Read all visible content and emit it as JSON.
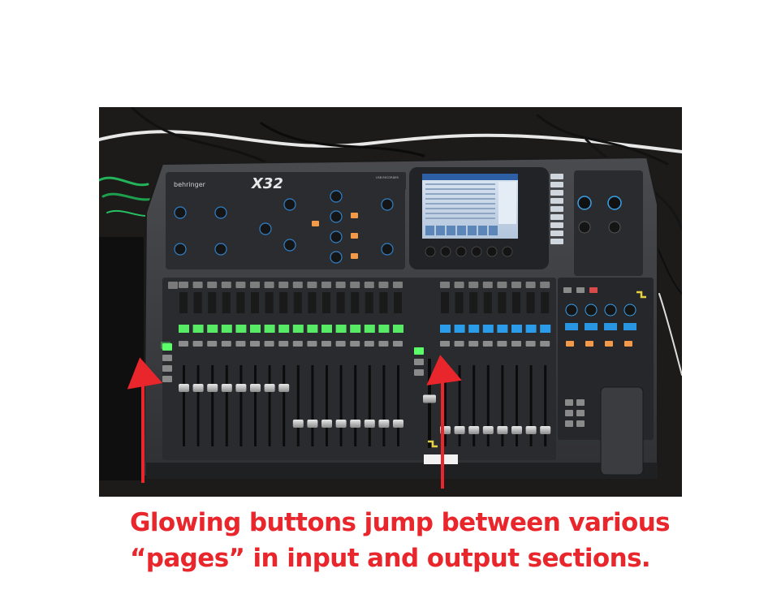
{
  "photo": {
    "subject": "digital-mixing-console",
    "brand_text": "behringer",
    "model_text": "X32",
    "usb_label": "USB RECORDER",
    "colors": {
      "background": "#ffffff",
      "annotation_red": "#e8262b",
      "led_green": "#5cff6a",
      "led_orange": "#f29a48",
      "lcd_blue": "#2aa8ff",
      "screen": "#c9d8ea",
      "console_body": "#3a3b3e",
      "console_panel": "#2b2c2f"
    },
    "input_fader_levels": [
      0.72,
      0.72,
      0.72,
      0.72,
      0.72,
      0.72,
      0.72,
      0.72,
      0.28,
      0.28,
      0.28,
      0.28,
      0.28,
      0.28,
      0.28,
      0.28
    ],
    "output_fader_levels": [
      0.2,
      0.2,
      0.2,
      0.2,
      0.2,
      0.2,
      0.2,
      0.2
    ],
    "main_fader_level": 0.55
  },
  "arrows": [
    {
      "name": "input-section-arrow",
      "points_to": "input-layer-buttons"
    },
    {
      "name": "output-section-arrow",
      "points_to": "output-layer-buttons"
    }
  ],
  "caption": {
    "line1": "Glowing buttons jump between various",
    "line2": "“pages” in input and output sections."
  }
}
